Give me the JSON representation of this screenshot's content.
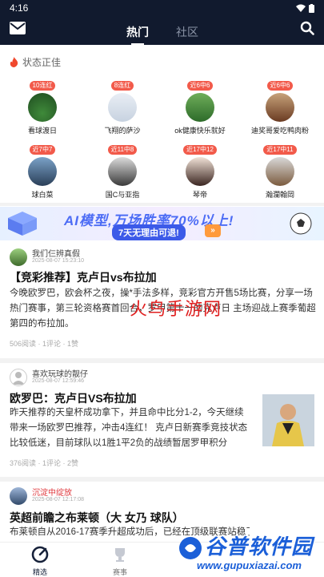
{
  "status_bar": {
    "time": "4:16"
  },
  "header": {
    "tabs": [
      {
        "label": "热门",
        "active": true
      },
      {
        "label": "社区",
        "active": false
      }
    ],
    "background": "#111a2e"
  },
  "section": {
    "title": "状态正佳"
  },
  "experts": [
    {
      "badge": "10连红",
      "name": "看球渡日"
    },
    {
      "badge": "8连红",
      "name": "飞翔的萨沙"
    },
    {
      "badge": "近6中6",
      "name": "ok健康快乐就好"
    },
    {
      "badge": "近6中6",
      "name": "迪奖哥爱吃鸭肉粉"
    },
    {
      "badge": "近7中7",
      "name": "球白菜"
    },
    {
      "badge": "近11中8",
      "name": "国C与亚指"
    },
    {
      "badge": "近17中12",
      "name": "琴帝"
    },
    {
      "badge": "近17中11",
      "name": "瀚瀾翰岡"
    }
  ],
  "banner": {
    "headline": "AI模型,万场胜率70%以上!",
    "cta": "7天无理由可退!"
  },
  "posts": [
    {
      "author": "我们仨辨真假",
      "date": "2025-08-07 15:23:10",
      "title": "【竞彩推荐】克卢日vs布拉加",
      "body": "今晚欧罗巴，欧会杯之夜，操*手法多样，竞彩官方开售5场比赛，分享一场热门赛事，第三轮资格赛首回合，罗甲第十一的克卢日 主场迎战上赛季葡超第四的布拉加。",
      "reads": "506阅读",
      "comments": "1评论",
      "likes": "1赞"
    },
    {
      "author": "喜欢玩球的靓仔",
      "date": "2025-08-07 12:59:46",
      "title": "欧罗巴：克卢日VS布拉加",
      "body": "昨天推荐的天皇杯成功拿下，并且命中比分1-2，今天继续带来一场欧罗巴推荐，冲击4连红！ 克卢日新赛季竞技状态比较低迷，目前球队以1胜1平2负的战绩暂居罗甲积分",
      "reads": "376阅读",
      "comments": "1评论",
      "likes": "2赞"
    },
    {
      "author": "沉淀中绽放",
      "date": "2025-08-07 12:17:08",
      "title": "英超前瞻之布莱顿（大 女乃 球队）",
      "body": "布莱顿自从2016-17赛季升超成功后，已经在顶级联赛站稳了",
      "author_color": "#e0393e"
    }
  ],
  "watermark": "火鸟手游网",
  "bottom_nav": [
    {
      "label": "精选",
      "active": true
    },
    {
      "label": "赛事",
      "active": false
    }
  ],
  "brand": {
    "name": "谷普软件园",
    "url": "www.gupuxiazai.com"
  },
  "colors": {
    "accent_red": "#f25a4a",
    "nav_dark": "#111a2e",
    "brand_blue": "#1b5fd8"
  }
}
